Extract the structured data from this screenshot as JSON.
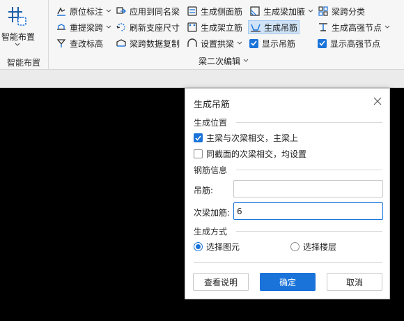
{
  "ribbon": {
    "big_button": {
      "label": "智能布置",
      "icon": "grid-layout-icon"
    },
    "big_group_label": "智能布置",
    "group_label": "梁二次编辑",
    "col1": [
      {
        "label": "原位标注",
        "icon": "annotation-icon",
        "dropdown": true
      },
      {
        "label": "重提梁跨",
        "icon": "span-icon",
        "dropdown": true
      },
      {
        "label": "查改标高",
        "icon": "elevation-icon",
        "dropdown": false
      }
    ],
    "col2": [
      {
        "label": "应用到同名梁",
        "icon": "apply-same-icon"
      },
      {
        "label": "刷新支座尺寸",
        "icon": "refresh-support-icon"
      },
      {
        "label": "梁跨数据复制",
        "icon": "copy-span-icon"
      }
    ],
    "col3": [
      {
        "label": "生成侧面筋",
        "icon": "side-rebar-icon"
      },
      {
        "label": "生成架立筋",
        "icon": "erect-rebar-icon"
      },
      {
        "label": "设置拱梁",
        "icon": "arch-beam-icon",
        "dropdown": true
      }
    ],
    "col4": [
      {
        "label": "生成梁加腋",
        "icon": "haunch-icon",
        "dropdown": true
      },
      {
        "label": "生成吊筋",
        "icon": "hanger-rebar-icon",
        "active": true
      },
      {
        "label": "显示吊筋",
        "checked": true
      }
    ],
    "col5": [
      {
        "label": "梁跨分类",
        "icon": "classify-icon"
      },
      {
        "label": "生成高强节点",
        "icon": "high-strength-node-icon",
        "dropdown": true
      },
      {
        "label": "显示高强节点",
        "checked": true
      }
    ]
  },
  "dialog": {
    "title": "生成吊筋",
    "section_position": "生成位置",
    "opt_main_secondary": {
      "label": "主梁与次梁相交，主梁上",
      "checked": true
    },
    "opt_same_section": {
      "label": "同截面的次梁相交，均设置",
      "checked": false
    },
    "section_rebar": "钢筋信息",
    "hanger_label": "吊筋:",
    "hanger_value": "",
    "secondary_label": "次梁加筋:",
    "secondary_value": "6",
    "section_method": "生成方式",
    "radio_select_element": {
      "label": "选择图元",
      "selected": true
    },
    "radio_select_floor": {
      "label": "选择楼层",
      "selected": false
    },
    "btn_help": "查看说明",
    "btn_ok": "确定",
    "btn_cancel": "取消"
  },
  "colors": {
    "accent": "#1a73d9",
    "canvas": "#000000",
    "ribbon": "#f6f6f6"
  }
}
